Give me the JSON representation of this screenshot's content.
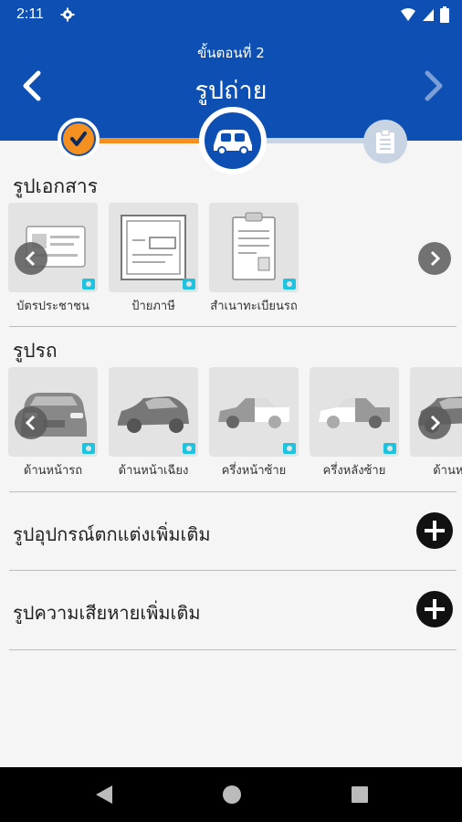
{
  "status_bar": {
    "time": "2:11",
    "icons": [
      "gear-icon",
      "wifi-icon",
      "signal-icon",
      "battery-icon"
    ]
  },
  "header": {
    "step_label": "ขั้นตอนที่ 2",
    "title": "รูปถ่าย"
  },
  "progress": {
    "steps": [
      "check-icon",
      "car-icon",
      "clipboard-icon"
    ],
    "current_step": 2
  },
  "documents": {
    "title": "รูปเอกสาร",
    "items": [
      {
        "label": "บัตรประชาชน",
        "icon": "id-card-icon"
      },
      {
        "label": "ป้ายภาษี",
        "icon": "tax-sign-icon"
      },
      {
        "label": "สำเนาทะเบียนรถ",
        "icon": "registration-doc-icon"
      }
    ]
  },
  "car_photos": {
    "title": "รูปรถ",
    "items": [
      {
        "label": "ด้านหน้ารถ",
        "icon": "car-front-icon"
      },
      {
        "label": "ด้านหน้าเฉียง",
        "icon": "car-front-angle-icon"
      },
      {
        "label": "ครึ่งหน้าซ้าย",
        "icon": "car-front-left-icon"
      },
      {
        "label": "ครึ่งหลังซ้าย",
        "icon": "car-rear-left-icon"
      },
      {
        "label": "ด้านหลัง",
        "icon": "car-rear-angle-icon"
      }
    ]
  },
  "extra": [
    {
      "label": "รูปอุปกรณ์ตกแต่งเพิ่มเติม"
    },
    {
      "label": "รูปความเสียหายเพิ่มเติม"
    }
  ],
  "colors": {
    "primary": "#0d4fb3",
    "accent": "#f39020",
    "inactive": "#c9d4e3",
    "camera": "#1ec3e0"
  }
}
